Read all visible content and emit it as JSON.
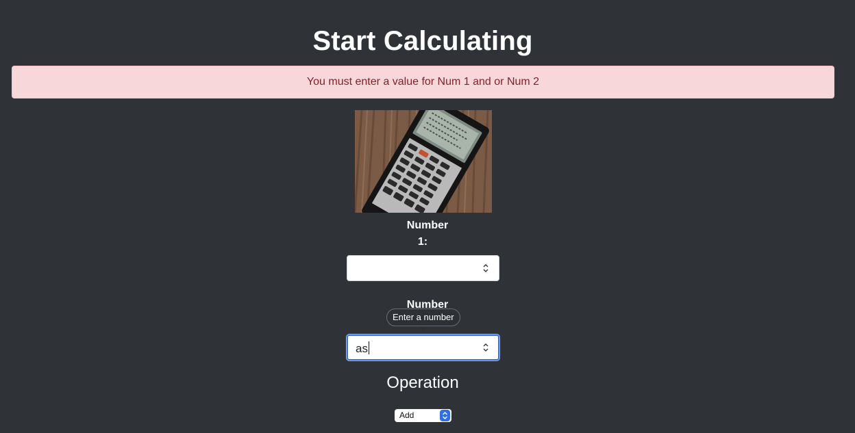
{
  "header": {
    "title": "Start Calculating"
  },
  "alert": {
    "message": "You must enter a value for Num 1 and or Num 2"
  },
  "form": {
    "num1": {
      "label_line1": "Number",
      "label_line2": "1:",
      "value": ""
    },
    "num2": {
      "label_line1": "Number",
      "value": "as",
      "tooltip": "Enter a number"
    },
    "operation": {
      "heading": "Operation",
      "selected": "Add"
    }
  },
  "colors": {
    "background": "#2f3338",
    "alert_bg": "#f8d7da",
    "alert_text": "#842029",
    "focus_ring": "#3a74e0",
    "select_accent": "#2f6fe4"
  },
  "icons": {
    "image": "calculator-photo",
    "spinner": "spinner-arrows-icon",
    "select": "select-arrows-icon"
  }
}
